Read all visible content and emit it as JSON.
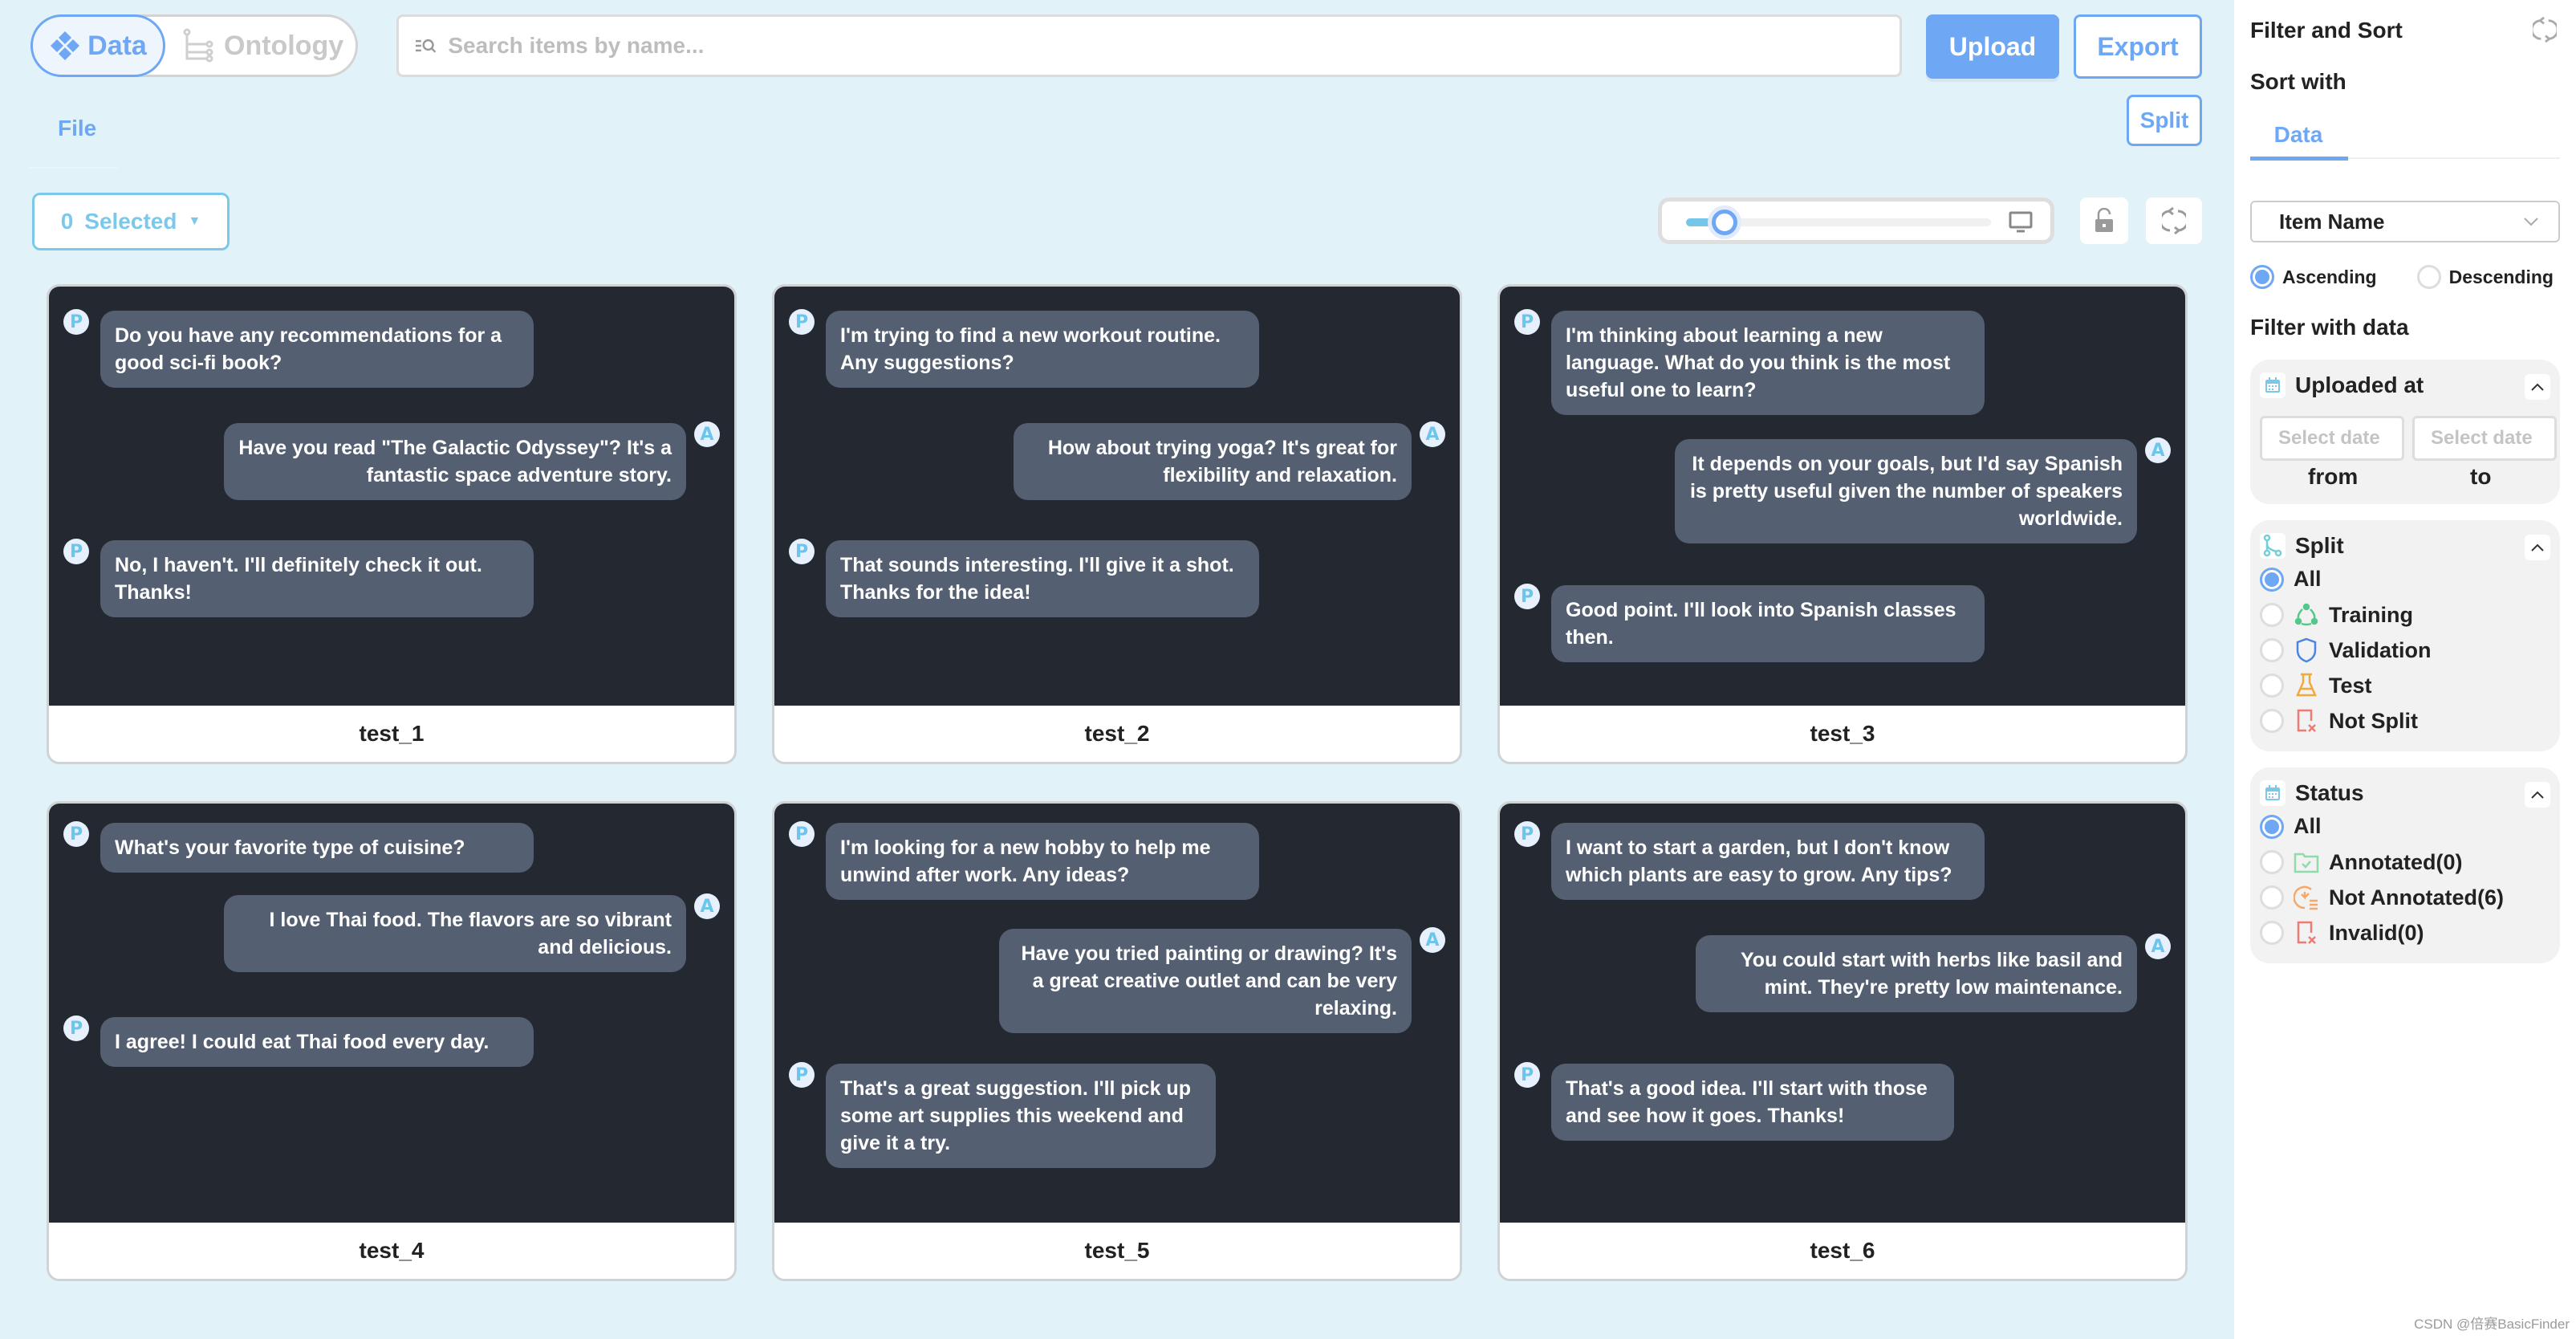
{
  "header": {
    "toggle": {
      "data_label": "Data",
      "ontology_label": "Ontology",
      "active": "Data"
    },
    "search": {
      "placeholder": "Search items by name...",
      "value": ""
    },
    "upload_label": "Upload",
    "export_label": "Export"
  },
  "subheader": {
    "file_tab": "File",
    "split_label": "Split",
    "selected_count": "0",
    "selected_label": "Selected",
    "zoom_slider_fraction": 0.1
  },
  "colors": {
    "accent": "#6ea8f5",
    "accent_light": "#7cc8ea",
    "background": "#e1f3f8",
    "card_dark": "#242831",
    "bubble": "#545f71"
  },
  "items": [
    {
      "name": "test_1",
      "messages": [
        {
          "role": "P",
          "text": "Do you have any recommendations for a good sci-fi book?"
        },
        {
          "role": "A",
          "text": "Have you read \"The Galactic Odyssey\"? It's a fantastic space adventure story."
        },
        {
          "role": "P",
          "text": "No, I haven't. I'll definitely check it out. Thanks!"
        }
      ]
    },
    {
      "name": "test_2",
      "messages": [
        {
          "role": "P",
          "text": "I'm trying to find a new workout routine. Any suggestions?"
        },
        {
          "role": "A",
          "text": "How about trying yoga? It's great for flexibility and relaxation."
        },
        {
          "role": "P",
          "text": "That sounds interesting. I'll give it a shot. Thanks for the idea!"
        }
      ]
    },
    {
      "name": "test_3",
      "messages": [
        {
          "role": "P",
          "text": "I'm thinking about learning a new language. What do you think is the most useful one to learn?"
        },
        {
          "role": "A",
          "text": "It depends on your goals, but I'd say Spanish is pretty useful given the number of speakers worldwide."
        },
        {
          "role": "P",
          "text": "Good point. I'll look into Spanish classes then."
        }
      ]
    },
    {
      "name": "test_4",
      "messages": [
        {
          "role": "P",
          "text": "What's your favorite type of cuisine?"
        },
        {
          "role": "A",
          "text": "I love Thai food. The flavors are so vibrant and delicious."
        },
        {
          "role": "P",
          "text": "I agree! I could eat Thai food every day."
        }
      ]
    },
    {
      "name": "test_5",
      "messages": [
        {
          "role": "P",
          "text": "I'm looking for a new hobby to help me unwind after work. Any ideas?"
        },
        {
          "role": "A",
          "text": "Have you tried painting or drawing? It's a great creative outlet and can be very relaxing."
        },
        {
          "role": "P",
          "text": "That's a great suggestion. I'll pick up some art supplies this weekend and give it a try."
        }
      ]
    },
    {
      "name": "test_6",
      "messages": [
        {
          "role": "P",
          "text": "I want to start a garden, but I don't know which plants are easy to grow. Any tips?"
        },
        {
          "role": "A",
          "text": "You could start with herbs like basil and mint. They're pretty low maintenance."
        },
        {
          "role": "P",
          "text": "That's a good idea. I'll start with those and see how it goes. Thanks!"
        }
      ]
    }
  ],
  "sidebar": {
    "title": "Filter and Sort",
    "sort_with": "Sort with",
    "sort_tab": "Data",
    "sort_field": "Item Name",
    "order": {
      "ascending": "Ascending",
      "descending": "Descending",
      "selected": "Ascending"
    },
    "filter_with": "Filter with data",
    "uploaded_at": {
      "title": "Uploaded at",
      "from_placeholder": "Select date",
      "to_placeholder": "Select date",
      "from_label": "from",
      "to_label": "to"
    },
    "split": {
      "title": "Split",
      "options": [
        "All",
        "Training",
        "Validation",
        "Test",
        "Not Split"
      ],
      "selected": "All"
    },
    "status": {
      "title": "Status",
      "options": [
        "All",
        "Annotated(0)",
        "Not Annotated(6)",
        "Invalid(0)"
      ],
      "selected": "All"
    }
  },
  "watermark": "CSDN @倍赛BasicFinder"
}
